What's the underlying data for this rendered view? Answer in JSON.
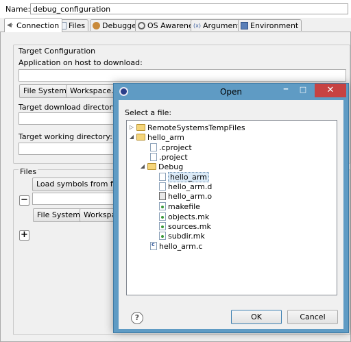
{
  "name_row": {
    "label": "Name:",
    "value": "debug_configuration"
  },
  "tabs": [
    {
      "label": "Connection",
      "icon": "connection-icon"
    },
    {
      "label": "Files",
      "icon": "files-icon"
    },
    {
      "label": "Debugger",
      "icon": "debugger-icon"
    },
    {
      "label": "OS Awareness",
      "icon": "os-awareness-icon"
    },
    {
      "label": "Arguments",
      "icon": "arguments-icon"
    },
    {
      "label": "Environment",
      "icon": "environment-icon"
    }
  ],
  "target": {
    "section_label": "Target Configuration",
    "app_label": "Application on host to download:",
    "app_value": "",
    "file_system_btn": "File System...",
    "workspace_btn": "Workspace...",
    "download_dir_label": "Target download directory:",
    "download_dir_value": "",
    "working_dir_label": "Target working directory:",
    "working_dir_value": ""
  },
  "files": {
    "section_label": "Files",
    "load_symbols_btn": "Load symbols from file",
    "minus_btn": "−",
    "file_system_btn": "File System...",
    "workspace_btn": "Workspace",
    "plus_btn": "+"
  },
  "dialog": {
    "title": "Open",
    "minimize": "‒",
    "maximize": "□",
    "close": "✕",
    "select_label": "Select a file:",
    "tree": [
      {
        "label": "RemoteSystemsTempFiles",
        "kind": "folder",
        "expand": "▷"
      },
      {
        "label": "hello_arm",
        "kind": "folder",
        "expand": "◢"
      },
      {
        "label": ".cproject",
        "kind": "file"
      },
      {
        "label": ".project",
        "kind": "file"
      },
      {
        "label": "Debug",
        "kind": "folder",
        "expand": "◢"
      },
      {
        "label": "hello_arm",
        "kind": "file",
        "selected": true
      },
      {
        "label": "hello_arm.d",
        "kind": "file"
      },
      {
        "label": "hello_arm.o",
        "kind": "bin"
      },
      {
        "label": "makefile",
        "kind": "mk"
      },
      {
        "label": "objects.mk",
        "kind": "mk"
      },
      {
        "label": "sources.mk",
        "kind": "mk"
      },
      {
        "label": "subdir.mk",
        "kind": "mk"
      },
      {
        "label": "hello_arm.c",
        "kind": "c"
      }
    ],
    "help": "?",
    "ok": "OK",
    "cancel": "Cancel"
  },
  "colors": {
    "dialog_frame": "#5f9bc4",
    "close_button": "#c74242",
    "selection": "#dbeaf7"
  }
}
